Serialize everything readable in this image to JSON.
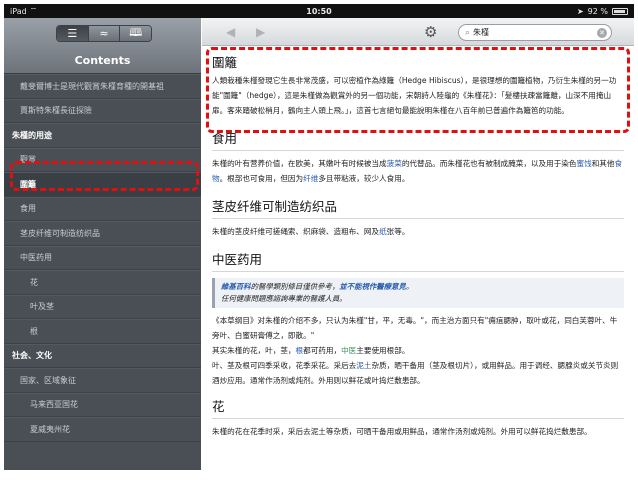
{
  "status_bar": {
    "carrier": "iPad",
    "time": "10:50",
    "battery": "92 %"
  },
  "sidebar": {
    "title": "Contents",
    "view_modes": [
      "list-icon",
      "waves-icon",
      "book-icon"
    ],
    "items": [
      {
        "label": "戴斐爾博士是現代觀賞朱槿育種的開基祖",
        "level": "l1"
      },
      {
        "label": "賈斯特朱槿長征探險",
        "level": "l1"
      },
      {
        "label": "朱槿的用途",
        "level": "head"
      },
      {
        "label": "觀賞",
        "level": "l1"
      },
      {
        "label": "圍籬",
        "level": "l1",
        "selected": true
      },
      {
        "label": "食用",
        "level": "l1"
      },
      {
        "label": "茎皮纤维可制造纺织品",
        "level": "l1"
      },
      {
        "label": "中医药用",
        "level": "l1"
      },
      {
        "label": "花",
        "level": "l2"
      },
      {
        "label": "叶及茎",
        "level": "l2"
      },
      {
        "label": "根",
        "level": "l2"
      },
      {
        "label": "社会、文化",
        "level": "head"
      },
      {
        "label": "国家、区域象征",
        "level": "l1"
      },
      {
        "label": "马来西亚国花",
        "level": "l2"
      },
      {
        "label": "夏威夷州花",
        "level": "l2"
      }
    ]
  },
  "toolbar": {
    "search_value": "朱槿"
  },
  "article": {
    "s1_title": "圍籬",
    "s1_text": "人類栽種朱槿發現它生長非常茂盛，可以密植作為綠籬（Hedge Hibiscus），是很理想的圍籬植物，乃衍生朱槿的另一功能\"圍籬\"（hedge），這是朱槿做為觀賞外的另一個功能，宋朝詩人陸龜的《朱槿花》：「髮樓扶疎當籬離，山深不用掩山扉。客來踏破松梢月，鶴向主人頭上飛。」，這首七言絕句最能說明朱槿在八百年前已普遍作為籬笆的功能。",
    "s2_title": "食用",
    "s2_a": "朱槿的叶有营养价值，在欧美，其嫩叶有时候被当成",
    "s2_l1": "菠菜",
    "s2_b": "的代替品。而朱槿花也有被制成腌菜，以及用于染色",
    "s2_l2": "蜜饯",
    "s2_c": "和其他",
    "s2_l3": "食物",
    "s2_d": "。根部也可食用，但因为",
    "s2_l4": "纤维",
    "s2_e": "多且带粘液，较少人食用。",
    "s3_title": "茎皮纤维可制造纺织品",
    "s3_a": "朱槿的茎皮纤维可搓绳索、织麻袋、造粗布、网及",
    "s3_l1": "纸",
    "s3_b": "张等。",
    "s4_title": "中医药用",
    "notice_link": "維基百科",
    "notice_a": "的醫學類別條目僅供參考，",
    "notice_b": "並不能視作醫療意見",
    "notice_c": "。",
    "notice_d": "任何健康問題應諮詢專業的醫護人員。",
    "s4_p1": "《本草纲目》对朱槿的介绍不多，只认为朱槿\"甘，平，无毒。\"，而主治方面只有\"痈疽腮肿，取叶或花，同白芙蓉叶、牛旁叶、白蜜研膏傅之，即散。\"",
    "s4_p2a": "其实朱槿的花，叶，茎，",
    "s4_p2l": "根",
    "s4_p2b": "都可药用，",
    "s4_p2g": "中医",
    "s4_p2c": "主要使用根部。",
    "s4_p3a": "叶、茎及根可四季采收，花季采花。采后去",
    "s4_p3l": "泥土",
    "s4_p3b": "杂质，晒干备用（茎及根切片），或用鲜品。用于调经、腮腺炎或关节炎则酒炒应用。通常作汤剂或炖剂。外用则以鲜花或叶捣烂敷患部。",
    "s5_title": "花",
    "s5_text": "朱槿的花在花季时采，采后去泥土等杂质，可晒干备用或用鲜品，通常作汤剂或炖剂。外用可以鲜花捣烂敷患部。"
  }
}
